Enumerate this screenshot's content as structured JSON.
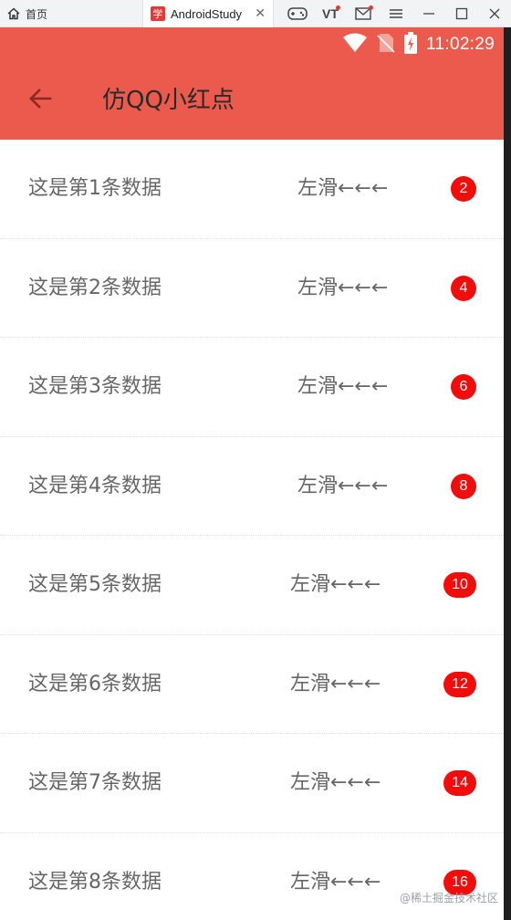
{
  "window": {
    "home_tab_label": "首页",
    "active_tab_title": "AndroidStudy",
    "active_tab_favicon": "学",
    "vt_label": "VT"
  },
  "status_bar": {
    "time": "11:02:29",
    "icons": [
      "wifi-icon",
      "no-sim-icon",
      "battery-charging-icon"
    ]
  },
  "toolbar": {
    "title": "仿QQ小红点",
    "back_icon": "arrow-back-icon"
  },
  "list": {
    "items": [
      {
        "label": "这是第1条数据",
        "swipe_hint": "左滑←←←",
        "badge": "2"
      },
      {
        "label": "这是第2条数据",
        "swipe_hint": "左滑←←←",
        "badge": "4"
      },
      {
        "label": "这是第3条数据",
        "swipe_hint": "左滑←←←",
        "badge": "6"
      },
      {
        "label": "这是第4条数据",
        "swipe_hint": "左滑←←←",
        "badge": "8"
      },
      {
        "label": "这是第5条数据",
        "swipe_hint": "左滑←←←",
        "badge": "10"
      },
      {
        "label": "这是第6条数据",
        "swipe_hint": "左滑←←←",
        "badge": "12"
      },
      {
        "label": "这是第7条数据",
        "swipe_hint": "左滑←←←",
        "badge": "14"
      },
      {
        "label": "这是第8条数据",
        "swipe_hint": "左滑←←←",
        "badge": "16"
      }
    ]
  },
  "watermark": "@稀土掘金技术社区",
  "colors": {
    "appbar": "#ec5a4d",
    "badge": "#f20d0d",
    "text": "#666666"
  }
}
